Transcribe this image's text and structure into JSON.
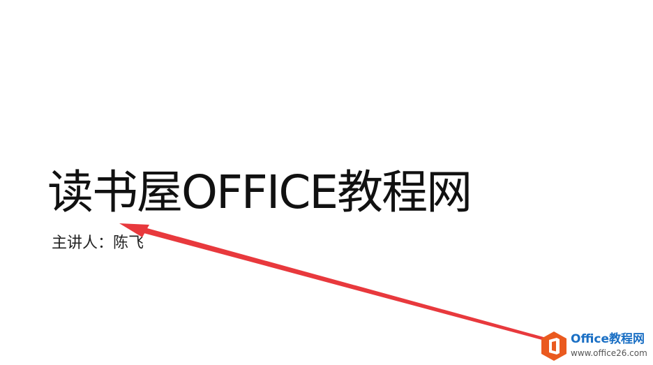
{
  "slide": {
    "title": "读书屋OFFICE教程网",
    "subtitle": "主讲人：陈飞"
  },
  "annotation": {
    "arrow_color": "#e8393d"
  },
  "watermark": {
    "name": "Office教程网",
    "url": "www.office26.com",
    "logo_color": "#ea5a1f",
    "name_color": "#1a6fc4"
  }
}
